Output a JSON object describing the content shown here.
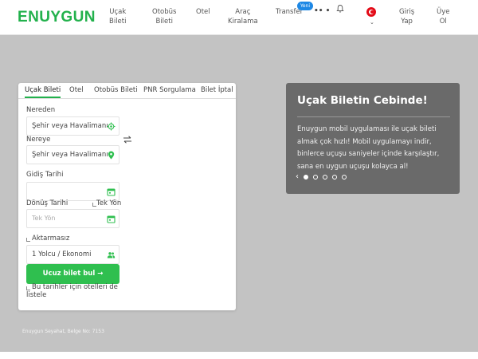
{
  "header": {
    "logo": "ENUYGUN",
    "nav": [
      {
        "line1": "Uçak",
        "line2": "Bileti"
      },
      {
        "line1": "Otobüs",
        "line2": "Bileti"
      },
      {
        "line1": "Otel",
        "line2": ""
      },
      {
        "line1": "Araç",
        "line2": "Kiralama"
      },
      {
        "line1": "Transfer",
        "line2": ""
      }
    ],
    "transfer_badge": "Yeni",
    "more_dots": "•• •",
    "login": {
      "line1": "Giriş",
      "line2": "Yap"
    },
    "signup": {
      "line1": "Üye",
      "line2": "Ol"
    }
  },
  "search": {
    "tabs": [
      "Uçak Bileti",
      "Otel",
      "Otobüs Bileti",
      "PNR Sorgulama",
      "Bilet İptal"
    ],
    "from_label": "Nereden",
    "from_value": "Şehir veya Havalimanı",
    "to_label": "Nereye",
    "to_value": "Şehir veya Havalimanı",
    "departure_label": "Gidiş Tarihi",
    "departure_value": "",
    "return_label": "Dönüş Tarihi",
    "one_way_label": "Tek Yön",
    "return_placeholder": "Tek Yön",
    "nonstop_label": "Aktarmasız",
    "passenger_value": "1 Yolcu / Ekonomi",
    "search_button": "Ucuz bilet bul →",
    "hotel_line1": "Bu tarihler için otelleri de",
    "hotel_line2": "listele"
  },
  "promo": {
    "title": "Uçak Biletin Cebinde!",
    "text": "Enuygun mobil uygulaması ile uçak bileti almak çok hızlı! Mobil uygulamayı indir, binlerce uçuşu saniyeler içinde karşılaştır, sana en uygun uçuşu kolayca al!",
    "prev_arrow": "‹",
    "slide_count": 5,
    "active_slide": 1
  },
  "footer": {
    "legal": "Enuygun Seyahat, Belge No: 7153"
  },
  "colors": {
    "brand_green": "#22b14c",
    "button_green": "#2fbf4f",
    "hero_bg": "#c3c3c3",
    "promo_bg": "#6a6a6a",
    "badge_blue": "#1e88e5"
  }
}
